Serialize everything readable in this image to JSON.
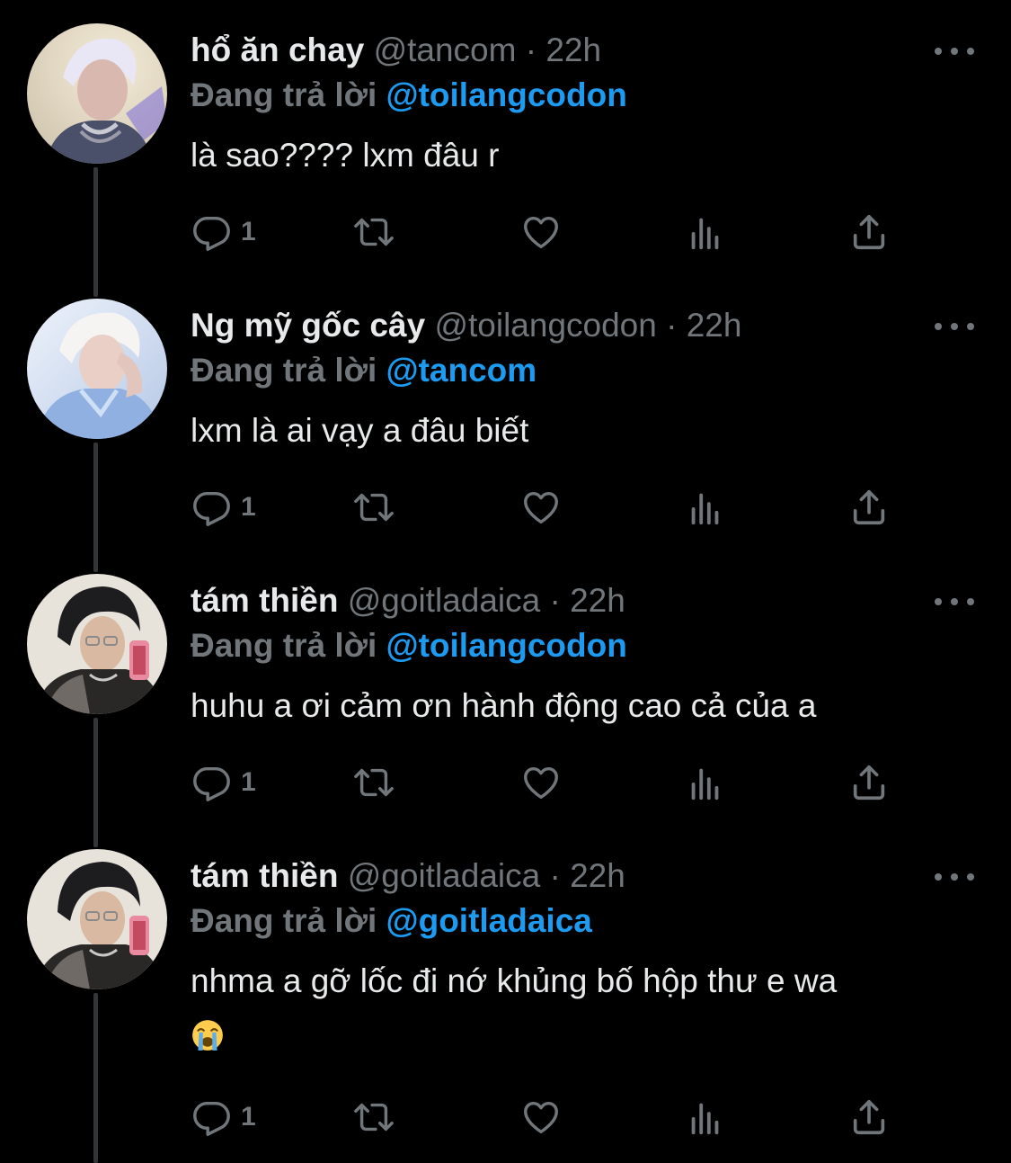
{
  "theme": {
    "background": "#000000",
    "text_primary": "#e7e9ea",
    "text_secondary": "#71767b",
    "accent": "#1d9bf0",
    "thread_line": "#333639"
  },
  "icons": {
    "reply": "reply-icon",
    "retweet": "retweet-icon",
    "like": "heart-icon",
    "views": "analytics-icon",
    "share": "share-icon",
    "more": "more-icon"
  },
  "tweets": [
    {
      "display_name": "hổ ăn chay",
      "handle": "@tancom",
      "separator": "·",
      "time": "22h",
      "reply_prefix": "Đang trả lời",
      "reply_to": "@toilangcodon",
      "text": "là sao???? lxm đâu r",
      "reply_count": "1"
    },
    {
      "display_name": "Ng mỹ gốc cây",
      "handle": "@toilangcodon",
      "separator": "·",
      "time": "22h",
      "reply_prefix": "Đang trả lời",
      "reply_to": "@tancom",
      "text": "lxm là ai vạy a đâu biết",
      "reply_count": "1"
    },
    {
      "display_name": "tám thiền",
      "handle": "@goitladaica",
      "separator": "·",
      "time": "22h",
      "reply_prefix": "Đang trả lời",
      "reply_to": "@toilangcodon",
      "text": "huhu a ơi cảm ơn hành động cao cả của a",
      "reply_count": "1"
    },
    {
      "display_name": "tám thiền",
      "handle": "@goitladaica",
      "separator": "·",
      "time": "22h",
      "reply_prefix": "Đang trả lời",
      "reply_to": "@goitladaica",
      "text": "nhma a gỡ lốc đi nớ khủng bố hộp thư e wa",
      "trailing_emoji": "loudly-crying-face-emoji",
      "reply_count": "1"
    }
  ]
}
